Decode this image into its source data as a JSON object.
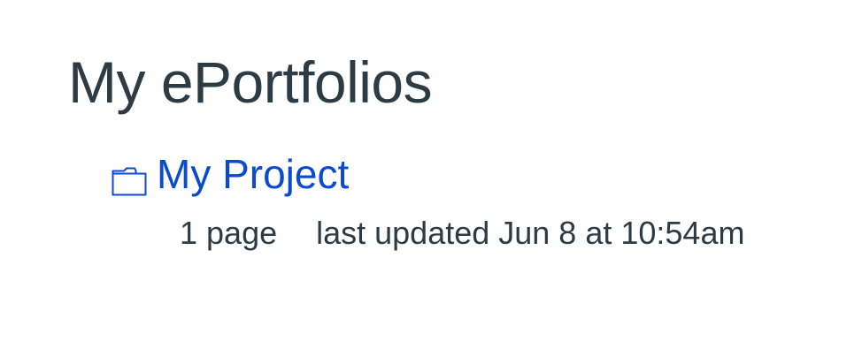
{
  "page": {
    "title": "My ePortfolios"
  },
  "portfolios": [
    {
      "name": "My Project",
      "icon": "folder-icon",
      "page_count": "1 page",
      "last_updated": "last updated Jun 8 at 10:54am"
    }
  ],
  "colors": {
    "link": "#0b4bcf",
    "text": "#2d3b45",
    "background": "#ffffff"
  }
}
